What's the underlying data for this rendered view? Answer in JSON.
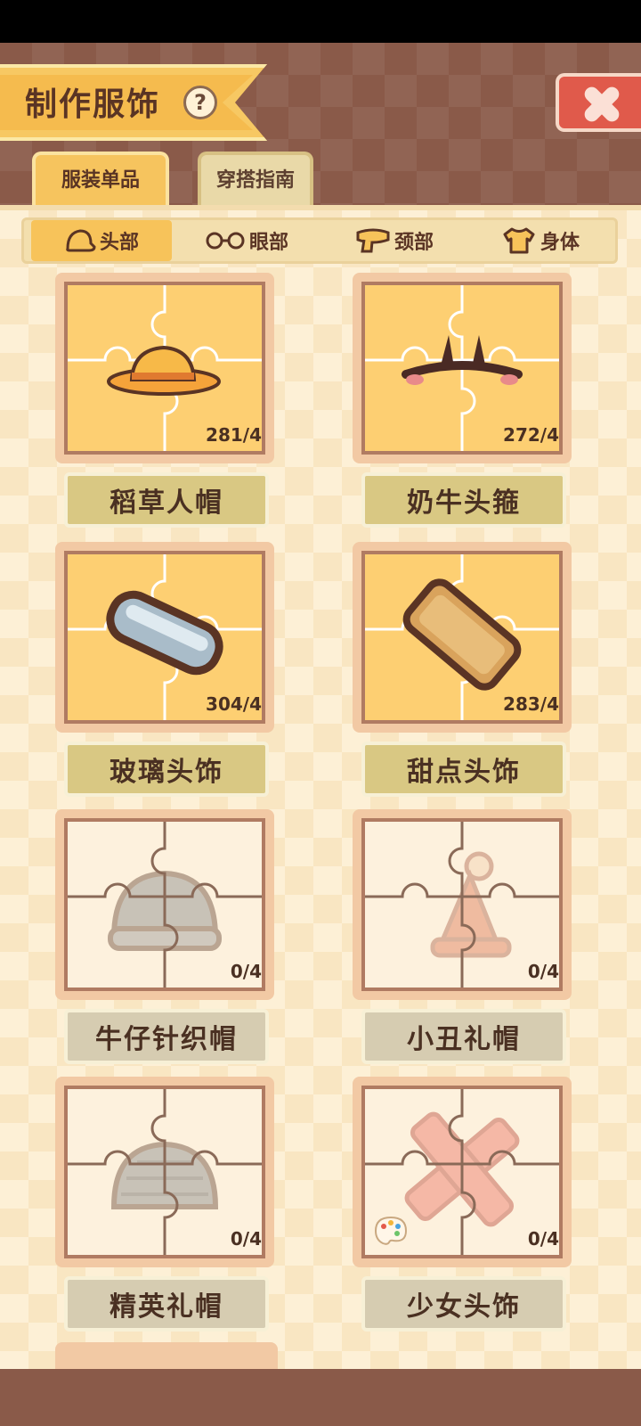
{
  "header": {
    "title": "制作服饰",
    "help_symbol": "?",
    "tabs": [
      {
        "label": "服装单品",
        "active": true
      },
      {
        "label": "穿搭指南",
        "active": false
      }
    ]
  },
  "categories": [
    {
      "label": "头部",
      "icon": "hat-icon",
      "active": true
    },
    {
      "label": "眼部",
      "icon": "glasses-icon",
      "active": false
    },
    {
      "label": "颈部",
      "icon": "scarf-icon",
      "active": false
    },
    {
      "label": "身体",
      "icon": "shirt-icon",
      "active": false
    }
  ],
  "items": [
    {
      "name": "稻草人帽",
      "count": "281/4",
      "owned": true,
      "icon": "straw-hat-icon"
    },
    {
      "name": "奶牛头箍",
      "count": "272/4",
      "owned": true,
      "icon": "cow-headband-icon"
    },
    {
      "name": "玻璃头饰",
      "count": "304/4",
      "owned": true,
      "icon": "glass-hairpin-icon"
    },
    {
      "name": "甜点头饰",
      "count": "283/4",
      "owned": true,
      "icon": "biscuit-hairpin-icon"
    },
    {
      "name": "牛仔针织帽",
      "count": "0/4",
      "owned": false,
      "icon": "knit-beanie-icon"
    },
    {
      "name": "小丑礼帽",
      "count": "0/4",
      "owned": false,
      "icon": "clown-hat-icon"
    },
    {
      "name": "精英礼帽",
      "count": "0/4",
      "owned": false,
      "icon": "elite-hat-icon"
    },
    {
      "name": "少女头饰",
      "count": "0/4",
      "owned": false,
      "icon": "girl-bow-icon",
      "palette": true
    }
  ],
  "colors": {
    "header_bg": "#8a5a49",
    "tile_owned": "#fdcf72",
    "tile_locked": "#fdf1dd",
    "close_red": "#e05a4b"
  }
}
